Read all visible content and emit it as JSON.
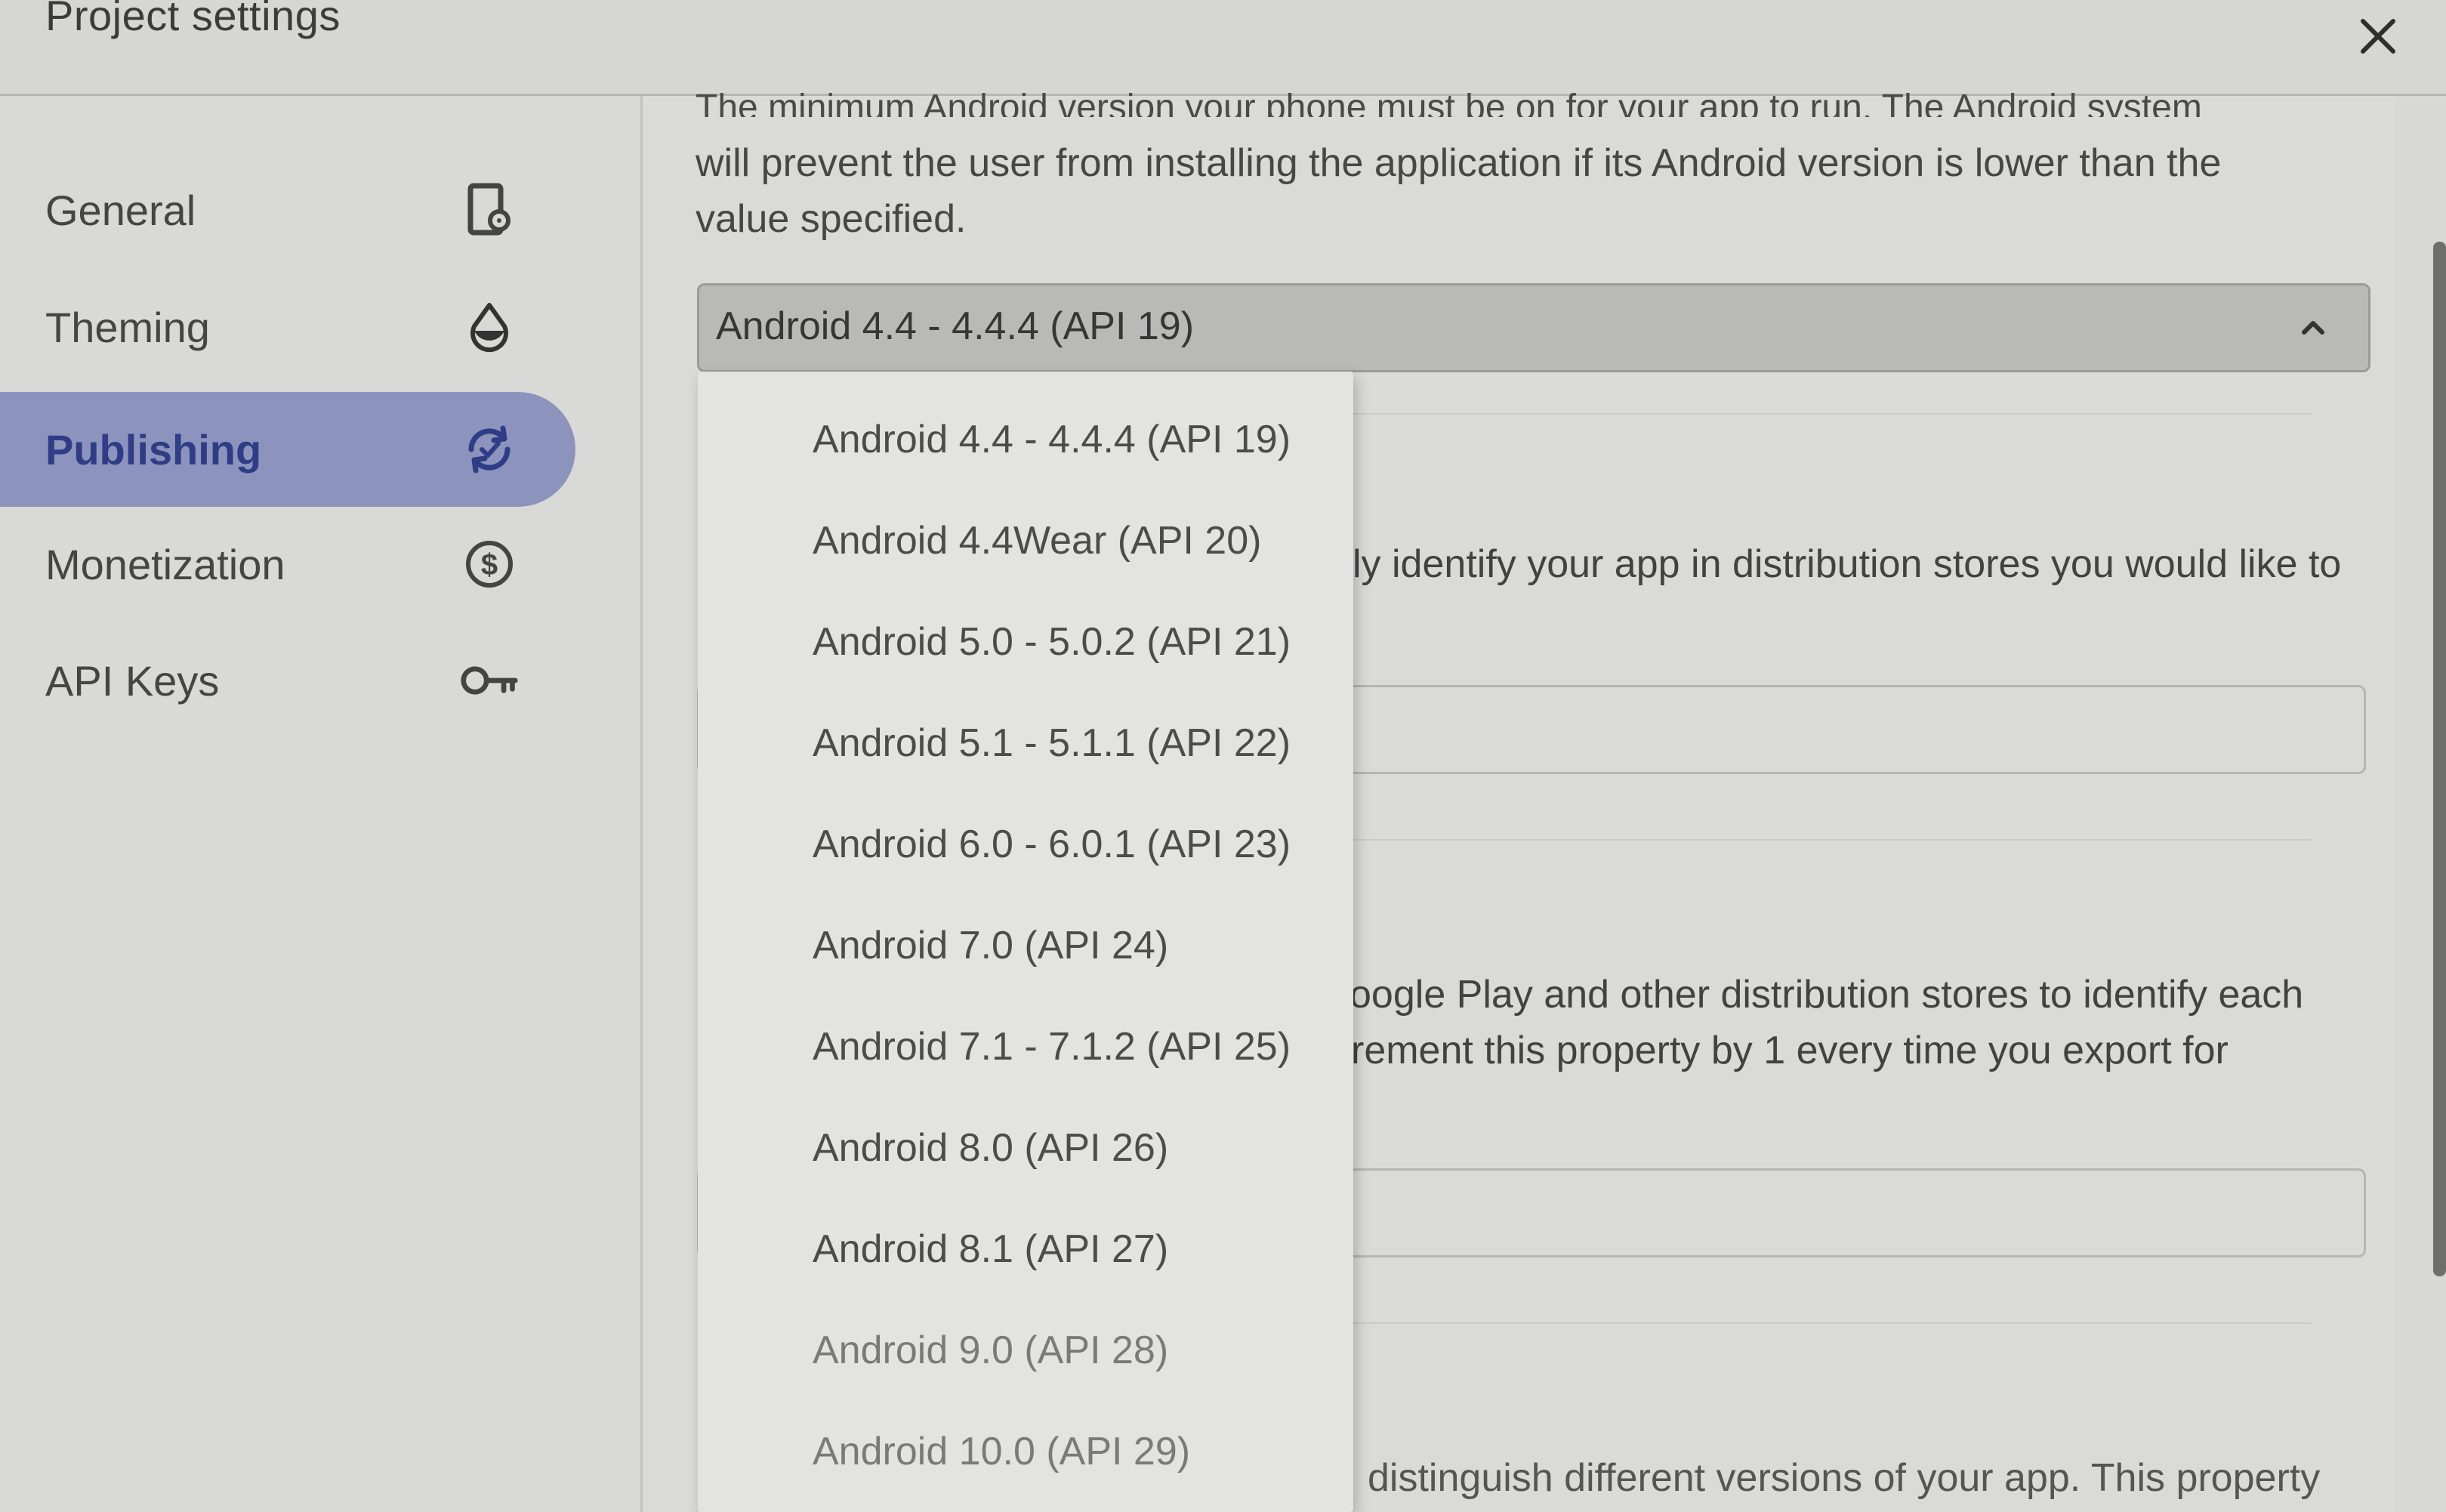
{
  "window": {
    "title": "Project settings"
  },
  "sidebar": {
    "items": [
      {
        "label": "General",
        "icon": "document-gear-icon",
        "active": false
      },
      {
        "label": "Theming",
        "icon": "paint-drop-icon",
        "active": false
      },
      {
        "label": "Publishing",
        "icon": "sync-icon",
        "active": true
      },
      {
        "label": "Monetization",
        "icon": "dollar-coin-icon",
        "active": false
      },
      {
        "label": "API Keys",
        "icon": "key-icon",
        "active": false
      }
    ]
  },
  "main": {
    "min_version_desc_cut": "The minimum Android version your phone must be on for your app to run. The Android system",
    "min_version_desc": "will prevent the user from installing the application if its Android version is lower than the value specified.",
    "min_version_select": {
      "value": "Android 4.4 - 4.4.4 (API 19)",
      "options": [
        "Android 4.4 - 4.4.4 (API 19)",
        "Android 4.4Wear (API 20)",
        "Android 5.0 - 5.0.2 (API 21)",
        "Android 5.1 - 5.1.1 (API 22)",
        "Android 6.0 - 6.0.1 (API 23)",
        "Android 7.0 (API 24)",
        "Android 7.1 - 7.1.2 (API 25)",
        "Android 8.0 (API 26)",
        "Android 8.1 (API 27)",
        "Android 9.0 (API 28)",
        "Android 10.0 (API 29)"
      ]
    },
    "partial_texts": {
      "package_desc": "ly identify your app in distribution stores you would like to",
      "version_code_line1": "oogle Play and other distribution stores to identify each",
      "version_code_line2": "rement this property by 1 every time you export for",
      "version_name_line1": "distinguish different versions of your app. This property"
    }
  },
  "colors": {
    "active_nav_bg": "#8c93bd",
    "active_nav_text": "#2f3d86"
  }
}
